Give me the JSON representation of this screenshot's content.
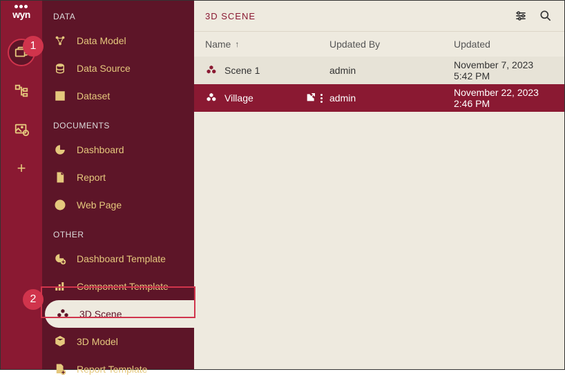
{
  "logo": "wyn",
  "callouts": {
    "one": "1",
    "two": "2"
  },
  "rail": {
    "items": [
      {
        "name": "documents-rail",
        "active": true
      },
      {
        "name": "tree-rail"
      },
      {
        "name": "image-rail"
      },
      {
        "name": "add-rail"
      }
    ]
  },
  "sidebar": {
    "sections": [
      {
        "title": "DATA",
        "items": [
          {
            "name": "data-model",
            "label": "Data Model",
            "icon": "model-icon"
          },
          {
            "name": "data-source",
            "label": "Data Source",
            "icon": "database-icon"
          },
          {
            "name": "dataset",
            "label": "Dataset",
            "icon": "grid-icon"
          }
        ]
      },
      {
        "title": "DOCUMENTS",
        "items": [
          {
            "name": "dashboard",
            "label": "Dashboard",
            "icon": "pie-icon"
          },
          {
            "name": "report",
            "label": "Report",
            "icon": "file-icon"
          },
          {
            "name": "web-page",
            "label": "Web Page",
            "icon": "globe-icon"
          }
        ]
      },
      {
        "title": "OTHER",
        "items": [
          {
            "name": "dashboard-template",
            "label": "Dashboard Template",
            "icon": "pie-plus-icon"
          },
          {
            "name": "component-template",
            "label": "Component Template",
            "icon": "component-icon"
          },
          {
            "name": "3d-scene",
            "label": "3D Scene",
            "icon": "cubes-icon",
            "selected": true
          },
          {
            "name": "3d-model",
            "label": "3D Model",
            "icon": "cube-icon"
          },
          {
            "name": "report-template",
            "label": "Report Template",
            "icon": "file-plus-icon"
          }
        ]
      }
    ]
  },
  "main": {
    "title": "3D SCENE",
    "columns": {
      "name": "Name",
      "updatedBy": "Updated By",
      "updated": "Updated"
    },
    "sortIndicator": "↑",
    "rows": [
      {
        "name": "Scene 1",
        "updatedBy": "admin",
        "updated": "November 7, 2023 5:42 PM",
        "selected": false
      },
      {
        "name": "Village",
        "updatedBy": "admin",
        "updated": "November 22, 2023 2:46 PM",
        "selected": true
      }
    ]
  }
}
